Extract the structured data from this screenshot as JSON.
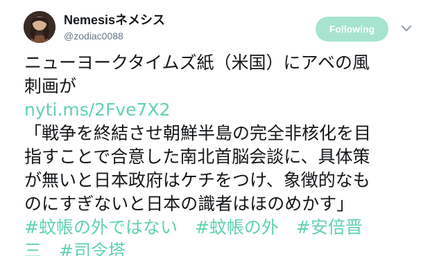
{
  "user": {
    "display_name": "Nemesisネメシス",
    "username": "@zodiac0088",
    "avatar_icon": "profile-avatar"
  },
  "actions": {
    "follow_label": "Following",
    "menu_icon": "chevron-down-icon"
  },
  "tweet": {
    "text_lines": [
      "ニューヨークタイムズ紙（米国）にアベの風",
      "刺画が"
    ],
    "link": "nyti.ms/2Fve7X2",
    "quote_lines": [
      "「戦争を終結させ朝鮮半島の完全非核化を目",
      "指すことで合意した南北首脳会談に、具体策",
      "が無いと日本政府はケチをつけ、象徴的なも",
      "のにすぎないと日本の識者はほのめかす」"
    ],
    "hashtags_line_1": "#蚊帳の外ではない　#蚊帳の外　#安倍晋",
    "hashtags_line_2": "三　#司令塔"
  },
  "colors": {
    "accent": "#5fd2b0",
    "follow_button_bg": "#a6e4cf",
    "text": "#14171a",
    "secondary_text": "#657786"
  }
}
